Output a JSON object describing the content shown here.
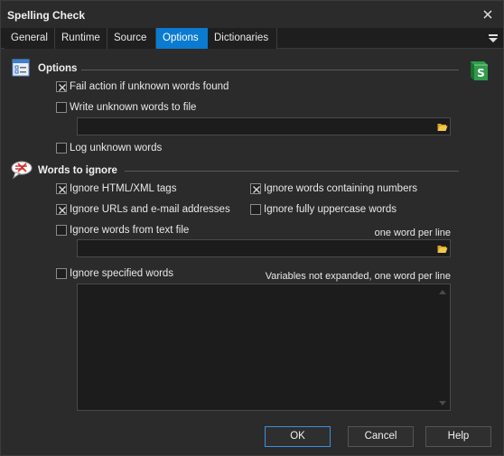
{
  "window": {
    "title": "Spelling Check"
  },
  "tabs": [
    {
      "label": "General",
      "active": false
    },
    {
      "label": "Runtime",
      "active": false
    },
    {
      "label": "Source",
      "active": false
    },
    {
      "label": "Options",
      "active": true
    },
    {
      "label": "Dictionaries",
      "active": false
    }
  ],
  "options": {
    "title": "Options",
    "fail_action": {
      "label": "Fail action if unknown words found",
      "checked": true
    },
    "write_unknown": {
      "label": "Write unknown words to file",
      "checked": false
    },
    "write_file_value": "",
    "log_unknown": {
      "label": "Log unknown words",
      "checked": false
    }
  },
  "words_to_ignore": {
    "title": "Words to ignore",
    "html_tags": {
      "label": "Ignore HTML/XML tags",
      "checked": true
    },
    "numbers": {
      "label": "Ignore words containing numbers",
      "checked": true
    },
    "urls": {
      "label": "Ignore URLs and e-mail addresses",
      "checked": true
    },
    "uppercase": {
      "label": "Ignore fully uppercase words",
      "checked": false
    },
    "from_file": {
      "label": "Ignore words from text file",
      "checked": false
    },
    "from_file_hint": "one word per line",
    "from_file_value": "",
    "specified": {
      "label": "Ignore specified words",
      "checked": false
    },
    "specified_hint": "Variables not expanded, one word per line",
    "specified_value": ""
  },
  "buttons": {
    "ok": "OK",
    "cancel": "Cancel",
    "help": "Help"
  },
  "colors": {
    "accent": "#0a7bd1",
    "background": "#2b2b2b",
    "field": "#1c1c1c"
  }
}
